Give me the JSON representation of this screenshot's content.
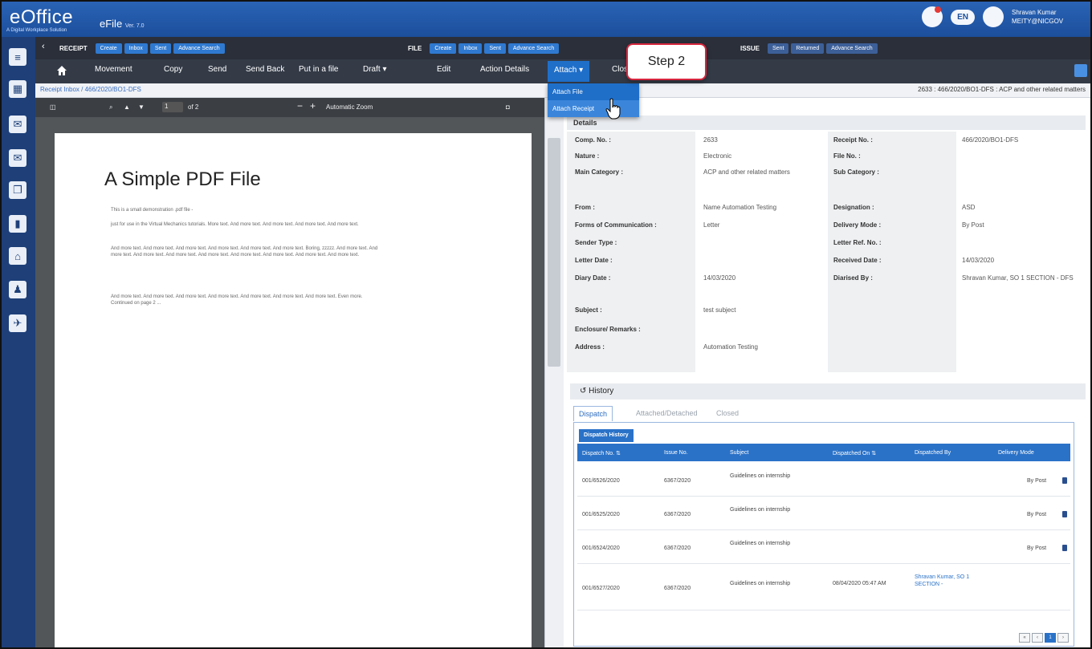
{
  "header": {
    "logo": "eOffice",
    "logo_sub": "A Digital Workplace Solution",
    "app_name": "eFile",
    "app_version": "Ver. 7.0",
    "lang_pill": "EN",
    "user_name": "Shravan Kumar",
    "user_role": "MEITY@NICGOV"
  },
  "modules": {
    "receipt": {
      "label": "RECEIPT",
      "buttons": [
        "Create",
        "Inbox",
        "Sent",
        "Advance Search"
      ]
    },
    "file": {
      "label": "FILE",
      "buttons": [
        "Create",
        "Inbox",
        "Sent",
        "Advance Search"
      ]
    },
    "issue": {
      "label": "ISSUE",
      "buttons": [
        "Sent",
        "Returned",
        "Advance Search"
      ]
    }
  },
  "actions": {
    "movement": "Movement",
    "copy": "Copy",
    "send": "Send",
    "send_back": "Send Back",
    "put_in_file": "Put in a file",
    "draft": "Draft ▾",
    "edit": "Edit",
    "action_details": "Action Details",
    "attach": "Attach ▾",
    "close": "Close"
  },
  "attach_menu": {
    "item1": "Attach File",
    "item2": "Attach Receipt"
  },
  "callout": {
    "text": "Step 2"
  },
  "breadcrumb": {
    "left": "Receipt Inbox  /  466/2020/BO1-DFS",
    "right": "2633 : 466/2020/BO1-DFS : ACP and other related matters"
  },
  "pdf": {
    "page_input": "1",
    "page_count": "of 2",
    "zoom": "Automatic Zoom",
    "title": "A Simple PDF File",
    "para1": "This is a small demonstration .pdf file -",
    "para2": "just for use in the Virtual Mechanics tutorials. More text. And more text. And more text. And more text. And more text.",
    "para3": "And more text. And more text. And more text. And more text. And more text. And more text. Boring, zzzzz. And more text. And more text. And more text. And more text. And more text. And more text. And more text. And more text. And more text.",
    "para4": "And more text. And more text. And more text. And more text. And more text. And more text. And more text. Even more. Continued on page 2 ..."
  },
  "details": {
    "heading": "Details",
    "rows": [
      {
        "l1": "Comp. No. :",
        "v1": "2633",
        "l2": "Receipt No. :",
        "v2": "466/2020/BO1-DFS"
      },
      {
        "l1": "Nature :",
        "v1": "Electronic",
        "l2": "File No. :",
        "v2": ""
      },
      {
        "l1": "Main Category :",
        "v1": "ACP and other related matters",
        "l2": "Sub Category :",
        "v2": ""
      },
      {
        "l1": "From :",
        "v1": "Name Automation Testing",
        "l2": "Designation :",
        "v2": "ASD"
      },
      {
        "l1": "Forms of Communication :",
        "v1": "Letter",
        "l2": "Delivery Mode :",
        "v2": "By Post"
      },
      {
        "l1": "Sender Type :",
        "v1": "",
        "l2": "Letter Ref. No. :",
        "v2": ""
      },
      {
        "l1": "Letter Date :",
        "v1": "",
        "l2": "Received Date :",
        "v2": "14/03/2020"
      },
      {
        "l1": "Diary Date :",
        "v1": "14/03/2020",
        "l2": "Diarised By :",
        "v2": "Shravan Kumar, SO 1 SECTION - DFS"
      },
      {
        "l1": "Subject :",
        "v1": "test subject",
        "l2": "",
        "v2": ""
      },
      {
        "l1": "Enclosure/ Remarks :",
        "v1": "",
        "l2": "",
        "v2": ""
      },
      {
        "l1": "Address :",
        "v1": "Automation Testing",
        "l2": "",
        "v2": ""
      }
    ]
  },
  "history": {
    "heading": "History",
    "tabs": [
      "Dispatch",
      "Attached/Detached",
      "Closed"
    ],
    "subtab": "Dispatch History",
    "columns": [
      "Dispatch No. ⇅",
      "Issue No.",
      "Subject",
      "Dispatched On ⇅",
      "Dispatched By",
      "Delivery Mode"
    ],
    "rows": [
      {
        "no": "001/6526/2020",
        "issue": "6367/2020",
        "subject": "Guidelines on internship",
        "on": "",
        "by": "",
        "mode": "By Post"
      },
      {
        "no": "001/6525/2020",
        "issue": "6367/2020",
        "subject": "Guidelines on internship",
        "on": "",
        "by": "",
        "mode": "By Post"
      },
      {
        "no": "001/6524/2020",
        "issue": "6367/2020",
        "subject": "Guidelines on internship",
        "on": "",
        "by": "",
        "mode": "By Post"
      },
      {
        "no": "001/6527/2020",
        "issue": "6367/2020",
        "subject": "Guidelines on internship",
        "on": "08/04/2020 05:47 AM",
        "by": "Shravan Kumar, SO 1 SECTION -",
        "mode": ""
      }
    ],
    "pager": [
      "«",
      "‹",
      "1",
      "›"
    ]
  }
}
